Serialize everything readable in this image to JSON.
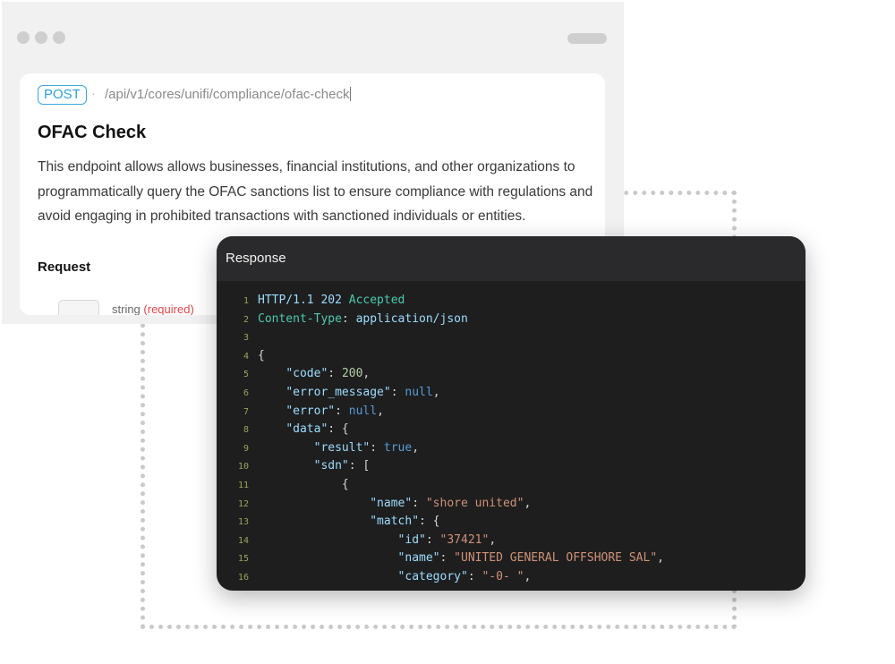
{
  "doc": {
    "method": "POST",
    "separator": "·",
    "path": "/api/v1/cores/unifi/compliance/ofac-check",
    "title": "OFAC Check",
    "description": "This endpoint allows allows businesses, financial institutions, and other organizations to programmatically query the OFAC sanctions list to ensure compliance with regulations and avoid engaging in prohibited transactions with sanctioned individuals or entities.",
    "request_heading": "Request",
    "param_partial_name": "string",
    "param_partial_req": "(required)"
  },
  "response": {
    "title": "Response",
    "lines": [
      {
        "n": "1",
        "indent": "",
        "parts": [
          {
            "t": "HTTP/1.1 202 ",
            "c": "c-blue"
          },
          {
            "t": "Accepted",
            "c": "c-green"
          }
        ]
      },
      {
        "n": "2",
        "indent": "",
        "parts": [
          {
            "t": "Content-Type",
            "c": "c-green"
          },
          {
            "t": ": ",
            "c": "c-punc"
          },
          {
            "t": "application/json",
            "c": "c-blue"
          }
        ]
      },
      {
        "n": "3",
        "indent": "",
        "parts": []
      },
      {
        "n": "4",
        "indent": "",
        "parts": [
          {
            "t": "{",
            "c": "c-punc"
          }
        ]
      },
      {
        "n": "5",
        "indent": "    ",
        "parts": [
          {
            "t": "\"code\"",
            "c": "c-key"
          },
          {
            "t": ": ",
            "c": "c-punc"
          },
          {
            "t": "200",
            "c": "c-num"
          },
          {
            "t": ",",
            "c": "c-punc"
          }
        ]
      },
      {
        "n": "6",
        "indent": "    ",
        "parts": [
          {
            "t": "\"error_message\"",
            "c": "c-key"
          },
          {
            "t": ": ",
            "c": "c-punc"
          },
          {
            "t": "null",
            "c": "c-kw"
          },
          {
            "t": ",",
            "c": "c-punc"
          }
        ]
      },
      {
        "n": "7",
        "indent": "    ",
        "parts": [
          {
            "t": "\"error\"",
            "c": "c-key"
          },
          {
            "t": ": ",
            "c": "c-punc"
          },
          {
            "t": "null",
            "c": "c-kw"
          },
          {
            "t": ",",
            "c": "c-punc"
          }
        ]
      },
      {
        "n": "8",
        "indent": "    ",
        "parts": [
          {
            "t": "\"data\"",
            "c": "c-key"
          },
          {
            "t": ": {",
            "c": "c-punc"
          }
        ]
      },
      {
        "n": "9",
        "indent": "        ",
        "parts": [
          {
            "t": "\"result\"",
            "c": "c-key"
          },
          {
            "t": ": ",
            "c": "c-punc"
          },
          {
            "t": "true",
            "c": "c-kw"
          },
          {
            "t": ",",
            "c": "c-punc"
          }
        ]
      },
      {
        "n": "10",
        "indent": "        ",
        "parts": [
          {
            "t": "\"sdn\"",
            "c": "c-key"
          },
          {
            "t": ": [",
            "c": "c-punc"
          }
        ]
      },
      {
        "n": "11",
        "indent": "            ",
        "parts": [
          {
            "t": "{",
            "c": "c-punc"
          }
        ]
      },
      {
        "n": "12",
        "indent": "                ",
        "parts": [
          {
            "t": "\"name\"",
            "c": "c-key"
          },
          {
            "t": ": ",
            "c": "c-punc"
          },
          {
            "t": "\"shore united\"",
            "c": "c-str"
          },
          {
            "t": ",",
            "c": "c-punc"
          }
        ]
      },
      {
        "n": "13",
        "indent": "                ",
        "parts": [
          {
            "t": "\"match\"",
            "c": "c-key"
          },
          {
            "t": ": {",
            "c": "c-punc"
          }
        ]
      },
      {
        "n": "14",
        "indent": "                    ",
        "parts": [
          {
            "t": "\"id\"",
            "c": "c-key"
          },
          {
            "t": ": ",
            "c": "c-punc"
          },
          {
            "t": "\"37421\"",
            "c": "c-str"
          },
          {
            "t": ",",
            "c": "c-punc"
          }
        ]
      },
      {
        "n": "15",
        "indent": "                    ",
        "parts": [
          {
            "t": "\"name\"",
            "c": "c-key"
          },
          {
            "t": ": ",
            "c": "c-punc"
          },
          {
            "t": "\"UNITED GENERAL OFFSHORE SAL\"",
            "c": "c-str"
          },
          {
            "t": ",",
            "c": "c-punc"
          }
        ]
      },
      {
        "n": "16",
        "indent": "                    ",
        "parts": [
          {
            "t": "\"category\"",
            "c": "c-key"
          },
          {
            "t": ": ",
            "c": "c-punc"
          },
          {
            "t": "\"-0- \"",
            "c": "c-str"
          },
          {
            "t": ",",
            "c": "c-punc"
          }
        ]
      }
    ]
  }
}
